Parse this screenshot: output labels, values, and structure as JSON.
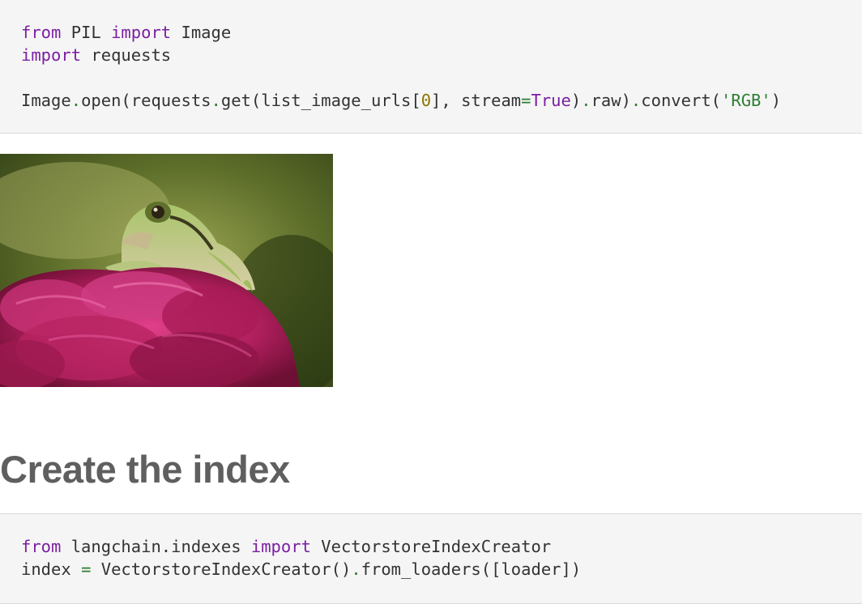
{
  "cells": [
    {
      "lines": [
        [
          {
            "t": "from",
            "k": "kw"
          },
          {
            "t": " PIL ",
            "k": "nm"
          },
          {
            "t": "import",
            "k": "kw"
          },
          {
            "t": " Image",
            "k": "nm"
          }
        ],
        [
          {
            "t": "import",
            "k": "kw"
          },
          {
            "t": " requests",
            "k": "nm"
          }
        ],
        [],
        [
          {
            "t": "Image",
            "k": "nm"
          },
          {
            "t": ".",
            "k": "op"
          },
          {
            "t": "open(requests",
            "k": "nm"
          },
          {
            "t": ".",
            "k": "op"
          },
          {
            "t": "get(list_image_urls[",
            "k": "nm"
          },
          {
            "t": "0",
            "k": "num"
          },
          {
            "t": "], stream",
            "k": "nm"
          },
          {
            "t": "=",
            "k": "op"
          },
          {
            "t": "True",
            "k": "kwc"
          },
          {
            "t": ")",
            "k": "nm"
          },
          {
            "t": ".",
            "k": "op"
          },
          {
            "t": "raw)",
            "k": "nm"
          },
          {
            "t": ".",
            "k": "op"
          },
          {
            "t": "convert(",
            "k": "nm"
          },
          {
            "t": "'RGB'",
            "k": "str"
          },
          {
            "t": ")",
            "k": "nm"
          }
        ]
      ]
    },
    {
      "lines": [
        [
          {
            "t": "from",
            "k": "kw"
          },
          {
            "t": " langchain.indexes ",
            "k": "nm"
          },
          {
            "t": "import",
            "k": "kw"
          },
          {
            "t": " VectorstoreIndexCreator",
            "k": "nm"
          }
        ],
        [
          {
            "t": "index ",
            "k": "nm"
          },
          {
            "t": "=",
            "k": "op"
          },
          {
            "t": " VectorstoreIndexCreator()",
            "k": "nm"
          },
          {
            "t": ".",
            "k": "op"
          },
          {
            "t": "from_loaders([loader])",
            "k": "nm"
          }
        ]
      ]
    }
  ],
  "output": {
    "image_subject": "frog-on-flower-photo"
  },
  "heading": "Create the index",
  "colors": {
    "keyword": "#7b1fa2",
    "operator": "#2e7d32",
    "number": "#8a7400",
    "string": "#2e7d32",
    "text": "#333333",
    "cell_bg": "#f5f5f5",
    "heading": "#5f5f5f"
  }
}
